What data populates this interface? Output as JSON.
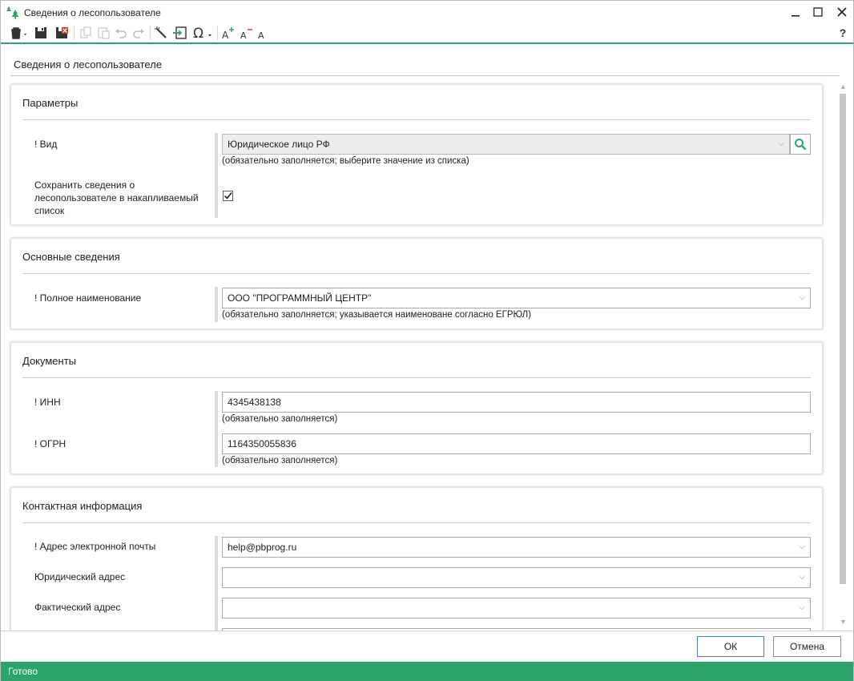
{
  "window": {
    "title": "Сведения о лесопользователе",
    "help": "?"
  },
  "header": {
    "title": "Сведения о лесопользователе"
  },
  "sections": {
    "params": {
      "title": "Параметры",
      "vid_label": "! Вид",
      "vid_value": "Юридическое лицо РФ",
      "vid_hint": "(обязательно заполняется; выберите значение из списка)",
      "save_label": "Сохранить сведения о лесопользователе в накапливаемый список",
      "save_checked": true
    },
    "main": {
      "title": "Основные сведения",
      "fullname_label": "! Полное наименование",
      "fullname_value": "ООО \"ПРОГРАММНЫЙ ЦЕНТР\"",
      "fullname_hint": "(обязательно заполняется; указывается наименоване согласно ЕГРЮЛ)"
    },
    "docs": {
      "title": "Документы",
      "inn_label": "! ИНН",
      "inn_value": "4345438138",
      "inn_hint": "(обязательно заполняется)",
      "ogrn_label": "! ОГРН",
      "ogrn_value": "1164350055836",
      "ogrn_hint": "(обязательно заполняется)"
    },
    "contacts": {
      "title": "Контактная информация",
      "email_label": "! Адрес электронной почты",
      "email_value": "help@pbprog.ru",
      "legal_label": "Юридический адрес",
      "legal_value": "",
      "actual_label": "Фактический адрес",
      "actual_value": ""
    }
  },
  "buttons": {
    "ok": "ОК",
    "cancel": "Отмена"
  },
  "status": {
    "text": "Готово"
  },
  "colors": {
    "accent": "#2ea46a"
  }
}
